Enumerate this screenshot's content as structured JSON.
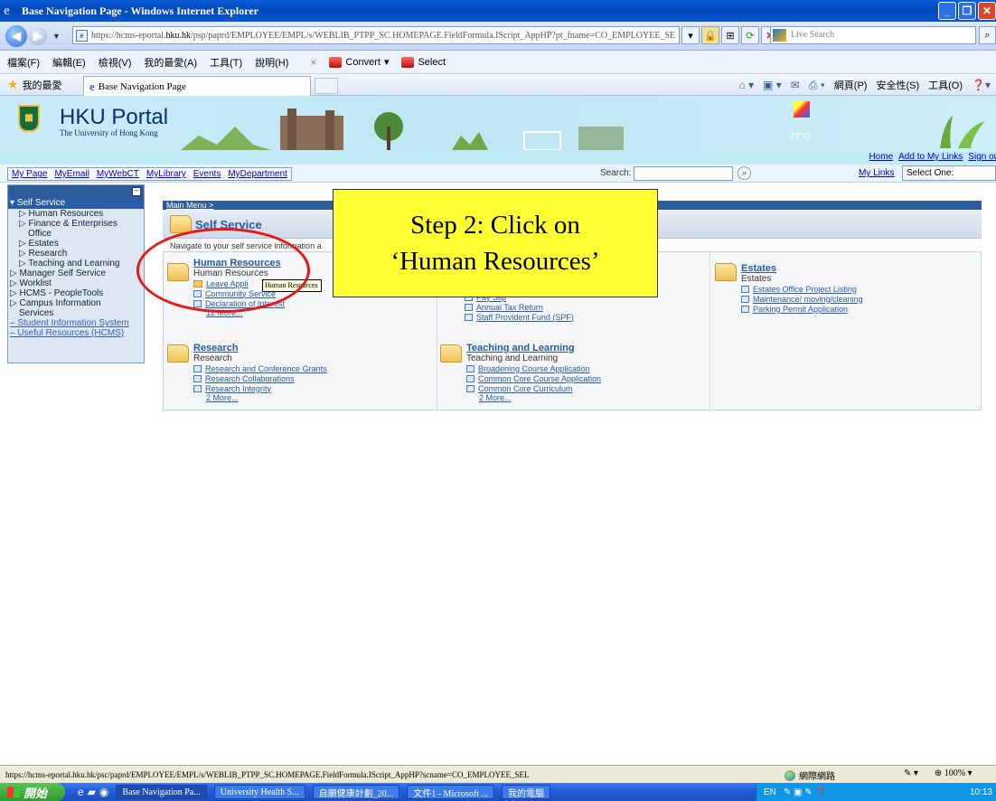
{
  "window": {
    "title": "Base Navigation Page - Windows Internet Explorer",
    "buttons": [
      "_",
      "❐",
      "✕"
    ]
  },
  "addressbar": {
    "url_prefix": "https://hcms-eportal.",
    "url_domain": "hku.hk",
    "url_rest": "/psp/paprd/EMPLOYEE/EMPL/s/WEBLIB_PTPP_SC.HOMEPAGE.FieldFormula.IScript_AppHP?pt_fname=CO_EMPLOYEE_SE",
    "live_search_placeholder": "Live Search"
  },
  "menubar": {
    "items": [
      "檔案(F)",
      "編輯(E)",
      "檢視(V)",
      "我的最愛(A)",
      "工具(T)",
      "說明(H)"
    ],
    "convert_label": "Convert",
    "select_label": "Select"
  },
  "favbar": {
    "favorites_label": "我的最愛",
    "tab_title": "Base Navigation Page",
    "cmd_items": [
      "網頁(P)",
      "安全性(S)",
      "工具(O)"
    ]
  },
  "portal": {
    "title": "HKU Portal",
    "subtitle": "The University of Hong Kong",
    "temperature": "27°C",
    "top_links": [
      "Home",
      "Add to My Links",
      "Sign out"
    ],
    "nav_tabs": [
      "My Page",
      "MyEmail",
      "MyWebCT",
      "MyLibrary",
      "Events",
      "MyDepartment"
    ],
    "search_label": "Search:",
    "search_btn": "»",
    "mylinks_label": "My Links",
    "mylinks_selected": "Select One:"
  },
  "leftmenu": {
    "selected": "▾ Self Service",
    "items": [
      {
        "label": "▷ Human Resources",
        "level": 1
      },
      {
        "label": "▷ Finance & Enterprises",
        "level": 1
      },
      {
        "label": "Office",
        "level": 2
      },
      {
        "label": "▷ Estates",
        "level": 1
      },
      {
        "label": "▷ Research",
        "level": 1
      },
      {
        "label": "▷ Teaching and Learning",
        "level": 1
      },
      {
        "label": "▷ Manager Self Service",
        "level": 0
      },
      {
        "label": "▷ Worklist",
        "level": 0
      },
      {
        "label": "▷ HCMS - PeopleTools",
        "level": 0
      },
      {
        "label": "▷ Campus Information",
        "level": 0
      },
      {
        "label": "Services",
        "level": 0
      }
    ],
    "links": [
      "– Student Information System",
      "– Useful Resources (HCMS)"
    ]
  },
  "main": {
    "breadcrumb": "Main Menu >",
    "title": "Self Service",
    "description": "Navigate to your self service information a",
    "cells": [
      {
        "title": "Human Resources",
        "sub": "Human Resources",
        "links": [
          "Leave Appli",
          "Community Service",
          "Declaration of Interest"
        ],
        "more": "12 More..."
      },
      {
        "title": "",
        "sub": "",
        "links": [
          "Pay Slip",
          "Annual Tax Return",
          "Staff Provident Fund (SPF)"
        ],
        "more": ""
      },
      {
        "title": "Estates",
        "sub": "Estates",
        "links": [
          "Estates Office Project Listing",
          "Maintenance/ moving/cleaning",
          "Parking Permit Application"
        ],
        "more": ""
      },
      {
        "title": "Research",
        "sub": "Research",
        "links": [
          "Research and Conference Grants",
          "Research Collaborations",
          "Research Integrity"
        ],
        "more": "2 More..."
      },
      {
        "title": "Teaching and Learning",
        "sub": "Teaching and Learning",
        "links": [
          "Broadening Course Application",
          "Common Core Course Application",
          "Common Core Curriculum"
        ],
        "more": "2 More..."
      }
    ],
    "tooltip": "Human Resources"
  },
  "callout": {
    "line1": "Step 2: Click on",
    "line2": "‘Human Resources’"
  },
  "statusbar": {
    "url": "https://hcms-eportal.hku.hk/psc/paprd/EMPLOYEE/EMPL/s/WEBLIB_PTPP_SC.HOMEPAGE.FieldFormula.IScript_AppHP?scname=CO_EMPLOYEE_SEL",
    "zone": "網際網路",
    "zoom": "100%"
  },
  "taskbar": {
    "start": "開始",
    "items": [
      "Base Navigation Pa...",
      "University Health S...",
      "自願健康計劃_20...",
      "文件1 - Microsoft ...",
      "我的電腦"
    ],
    "lang": "EN",
    "clock": "10:13"
  }
}
